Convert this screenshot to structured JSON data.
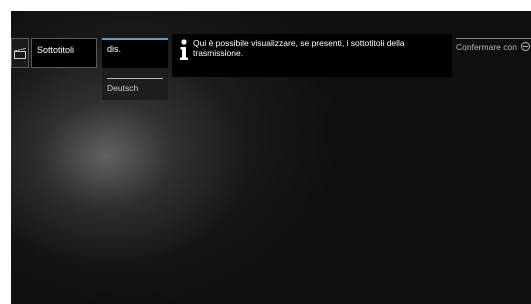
{
  "menu": {
    "icon": "clapperboard-icon",
    "title": "Sottotitoli"
  },
  "options": {
    "selected": "dis.",
    "items": [
      "Deutsch"
    ]
  },
  "info": {
    "icon": "info-icon",
    "text": "Qui è possibile visualizzare, se presenti, i sottotitoli della trasmissione."
  },
  "hint": {
    "label": "Confermare con",
    "button_icon": "ok-button-icon"
  },
  "colors": {
    "background": "#0f0f0f",
    "accent": "#5f9ec9",
    "text": "#ffffff"
  }
}
